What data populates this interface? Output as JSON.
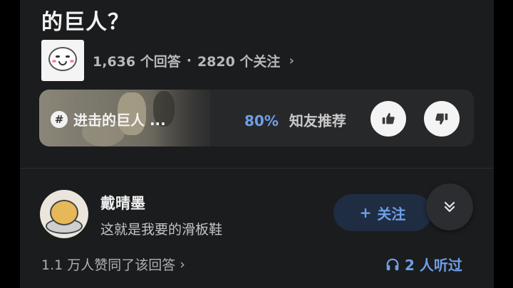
{
  "question": {
    "title": "的巨人？",
    "stats": {
      "answers": "1,636 个回答",
      "separator": "·",
      "followers": "2820 个关注",
      "chevron": "›"
    }
  },
  "topic_card": {
    "hash_icon": "#",
    "name": "进击的巨人 ...",
    "recommend_percent": "80%",
    "recommend_label": "知友推荐",
    "upvote_icon": "thumbs-up-icon",
    "downvote_icon": "thumbs-down-icon"
  },
  "answer": {
    "author_name": "戴晴墨",
    "author_bio": "这就是我要的滑板鞋",
    "follow_plus": "+",
    "follow_label": "关注",
    "collapse_icon": "double-chevron-down-icon",
    "likes_text": "1.1 万人赞同了该回答",
    "likes_chevron": "›",
    "listened_text": "2 人听过",
    "listened_icon": "headphones-icon"
  },
  "colors": {
    "panel_bg": "#1b1c1e",
    "accent_blue": "#6f9ee8",
    "follow_bg": "#1f2d42"
  }
}
